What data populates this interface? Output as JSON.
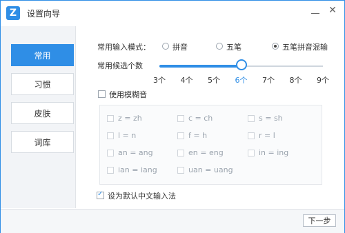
{
  "window": {
    "title": "设置向导",
    "app_icon": "Z"
  },
  "sidebar": {
    "items": [
      {
        "label": "常用",
        "active": true
      },
      {
        "label": "习惯",
        "active": false
      },
      {
        "label": "皮肤",
        "active": false
      },
      {
        "label": "词库",
        "active": false
      }
    ]
  },
  "input_mode": {
    "label": "常用输入模式：",
    "options": [
      {
        "label": "拼音",
        "checked": false
      },
      {
        "label": "五笔",
        "checked": false
      },
      {
        "label": "五笔拼音混输",
        "checked": true
      }
    ]
  },
  "candidates": {
    "label": "常用候选个数",
    "ticks": [
      "3个",
      "4个",
      "5个",
      "6个",
      "7个",
      "8个",
      "9个"
    ],
    "selected": "6个"
  },
  "fuzzy": {
    "label": "使用模糊音",
    "enabled": false,
    "items": [
      "z = zh",
      "c = ch",
      "s = sh",
      "l = n",
      "f = h",
      "r = l",
      "an = ang",
      "en = eng",
      "in = ing",
      "ian = iang",
      "uan = uang"
    ]
  },
  "default_ime": {
    "label": "设为默认中文输入法",
    "checked": true
  },
  "footer": {
    "next_label": "下一步"
  },
  "colors": {
    "accent": "#2f8ee6"
  }
}
